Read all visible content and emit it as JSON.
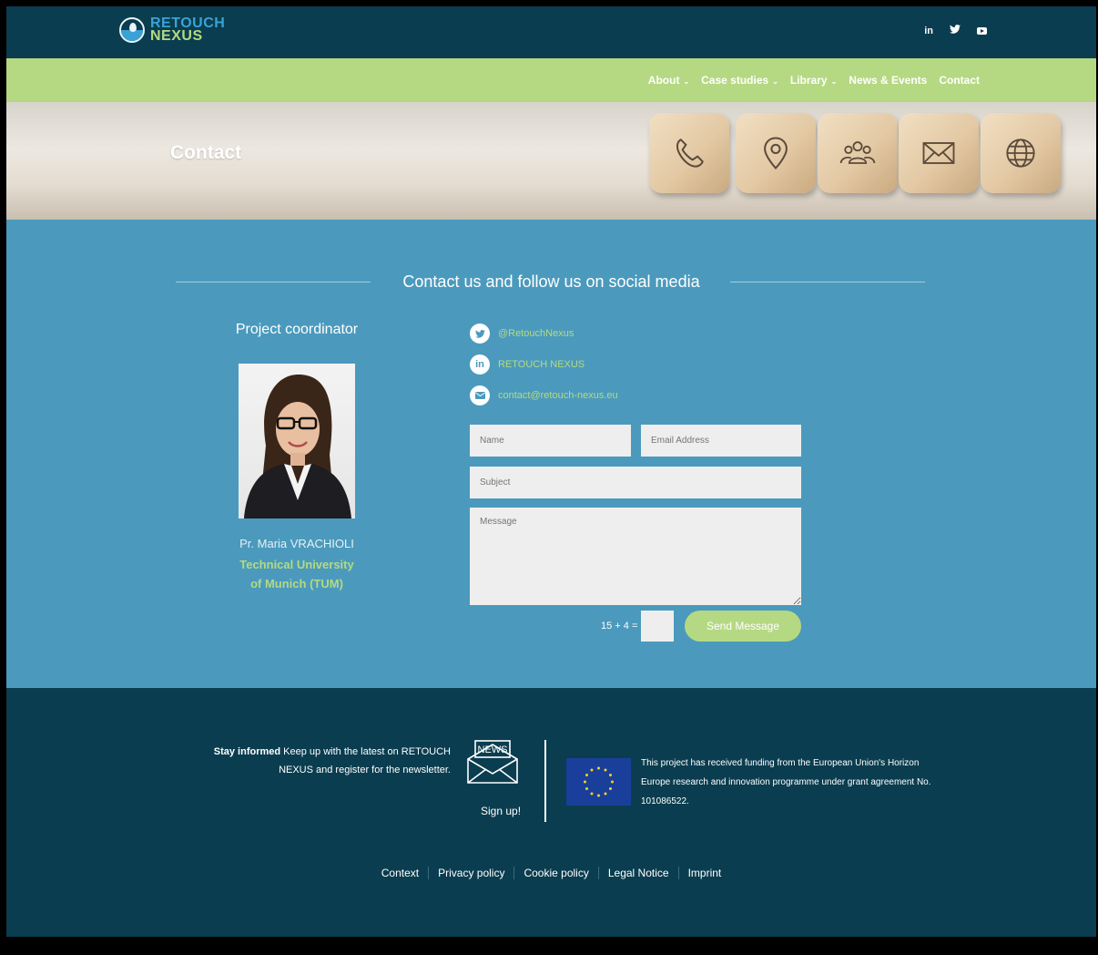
{
  "header": {
    "logo_line1": "RETOUCH",
    "logo_line2": "NEXUS",
    "social": {
      "linkedin": "in",
      "twitter_icon": "twitter-icon",
      "youtube_icon": "youtube-icon"
    }
  },
  "nav": {
    "items": [
      {
        "label": "About",
        "has_dropdown": true
      },
      {
        "label": "Case studies",
        "has_dropdown": true
      },
      {
        "label": "Library",
        "has_dropdown": true
      },
      {
        "label": "News & Events",
        "has_dropdown": false
      },
      {
        "label": "Contact",
        "has_dropdown": false
      }
    ],
    "chevron": "⌄"
  },
  "hero": {
    "title": "Contact",
    "cube_icons": [
      "phone-icon",
      "location-pin-icon",
      "people-icon",
      "envelope-icon",
      "globe-icon"
    ]
  },
  "contact": {
    "heading": "Contact us and follow us on social media",
    "coordinator": {
      "title": "Project coordinator",
      "name": "Pr. Maria VRACHIOLI",
      "org_line1": "Technical  University",
      "org_line2": "of Munich (TUM)"
    },
    "links": [
      {
        "icon": "twitter-icon",
        "text": "@RetouchNexus"
      },
      {
        "icon": "linkedin-icon",
        "text": "RETOUCH NEXUS"
      },
      {
        "icon": "email-icon",
        "text": "contact@retouch-nexus.eu"
      }
    ],
    "form": {
      "name_placeholder": "Name",
      "email_placeholder": "Email Address",
      "subject_placeholder": "Subject",
      "message_placeholder": "Message",
      "captcha": "15 + 4 =",
      "send_label": "Send Message"
    }
  },
  "footer": {
    "stay_bold": "Stay informed",
    "stay_text": " Keep up with the latest on RETOUCH NEXUS and register for the newsletter.",
    "news_label": "NEWS",
    "signup": "Sign up!",
    "eu_text": "This project has received funding from the European Union's Horizon Europe research and innovation programme under grant agreement No. 101086522.",
    "links": [
      "Context",
      "Privacy policy",
      "Cookie policy",
      "Legal Notice",
      "Imprint"
    ]
  },
  "colors": {
    "navy": "#0a3d4f",
    "green": "#b5d982",
    "blue": "#4b9abd"
  }
}
